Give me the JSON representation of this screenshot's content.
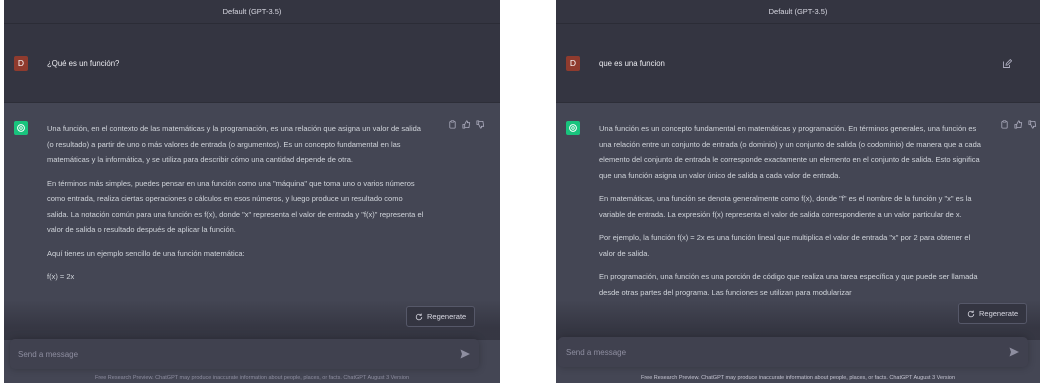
{
  "left": {
    "title": "Default (GPT-3.5)",
    "user_avatar": "D",
    "user_message": "¿Qué es un función?",
    "assistant_paragraphs": [
      "Una función, en el contexto de las matemáticas y la programación, es una relación que asigna un valor de salida (o resultado) a partir de uno o más valores de entrada (o argumentos). Es un concepto fundamental en las matemáticas y la informática, y se utiliza para describir cómo una cantidad depende de otra.",
      "En términos más simples, puedes pensar en una función como una \"máquina\" que toma uno o varios números como entrada, realiza ciertas operaciones o cálculos en esos números, y luego produce un resultado como salida. La notación común para una función es f(x), donde \"x\" representa el valor de entrada y \"f(x)\" representa el valor de salida o resultado después de aplicar la función.",
      "Aquí tienes un ejemplo sencillo de una función matemática:",
      "f(x) = 2x"
    ],
    "regenerate_label": "Regenerate",
    "input_placeholder": "Send a message",
    "footer": "Free Research Preview. ChatGPT may produce inaccurate information about people, places, or facts. ChatGPT August 3 Version"
  },
  "right": {
    "title": "Default (GPT-3.5)",
    "user_avatar": "D",
    "user_message": "que es una funcion",
    "assistant_paragraphs": [
      "Una función es un concepto fundamental en matemáticas y programación. En términos generales, una función es una relación entre un conjunto de entrada (o dominio) y un conjunto de salida (o codominio) de manera que a cada elemento del conjunto de entrada le corresponde exactamente un elemento en el conjunto de salida. Esto significa que una función asigna un valor único de salida a cada valor de entrada.",
      "En matemáticas, una función se denota generalmente como f(x), donde \"f\" es el nombre de la función y \"x\" es la variable de entrada. La expresión f(x) representa el valor de salida correspondiente a un valor particular de x.",
      "Por ejemplo, la función f(x) = 2x es una función lineal que multiplica el valor de entrada \"x\" por 2 para obtener el valor de salida.",
      "En programación, una función es una porción de código que realiza una tarea específica y que puede ser llamada desde otras partes del programa. Las funciones se utilizan para modularizar"
    ],
    "regenerate_label": "Regenerate",
    "input_placeholder": "Send a message",
    "footer": "Free Research Preview. ChatGPT may produce inaccurate information about people, places, or facts. ChatGPT August 3 Version"
  },
  "colors": {
    "background": "#343541",
    "assistant_bg": "#444654",
    "gpt_green": "#19c37d",
    "user_avatar": "#8f3b2e"
  },
  "icons": [
    "copy-icon",
    "thumbs-up-icon",
    "thumbs-down-icon",
    "edit-icon",
    "refresh-icon",
    "send-icon",
    "openai-logo-icon"
  ]
}
